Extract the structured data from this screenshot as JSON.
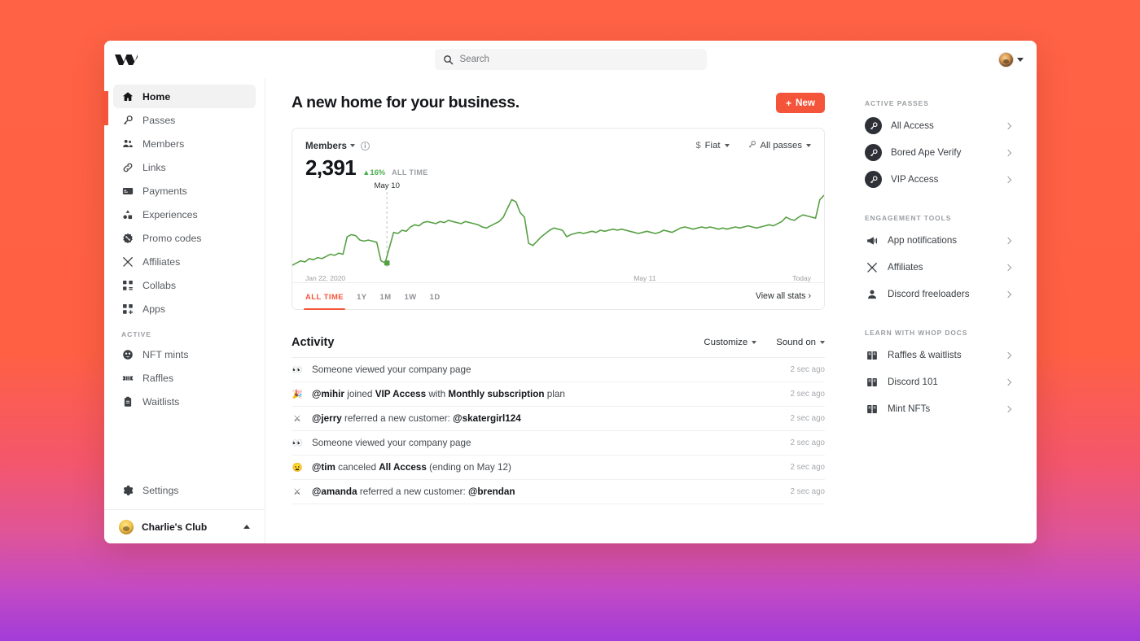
{
  "topbar": {
    "logo_name": "whop-logo",
    "search_placeholder": "Search",
    "search_value": ""
  },
  "sidebar": {
    "items": [
      {
        "label": "Home",
        "icon": "home-icon",
        "active": true
      },
      {
        "label": "Passes",
        "icon": "key-icon",
        "active": false
      },
      {
        "label": "Members",
        "icon": "people-icon",
        "active": false
      },
      {
        "label": "Links",
        "icon": "link-icon",
        "active": false
      },
      {
        "label": "Payments",
        "icon": "card-icon",
        "active": false
      },
      {
        "label": "Experiences",
        "icon": "experiences-icon",
        "active": false
      },
      {
        "label": "Promo codes",
        "icon": "promo-tag-icon",
        "active": false
      },
      {
        "label": "Affiliates",
        "icon": "crossed-swords-icon",
        "active": false
      },
      {
        "label": "Collabs",
        "icon": "collabs-icon",
        "active": false
      },
      {
        "label": "Apps",
        "icon": "apps-plus-icon",
        "active": false
      }
    ],
    "section_active_label": "ACTIVE",
    "active_items": [
      {
        "label": "NFT mints",
        "icon": "nft-mint-icon"
      },
      {
        "label": "Raffles",
        "icon": "ticket-icon"
      },
      {
        "label": "Waitlists",
        "icon": "clipboard-icon"
      }
    ],
    "settings_label": "Settings",
    "settings_icon": "gear-icon",
    "account_name": "Charlie's Club",
    "account_avatar": "charlie-avatar"
  },
  "main": {
    "page_title": "A new home for your business.",
    "new_button": "New",
    "new_button_icon": "plus-icon"
  },
  "stat_card": {
    "metric_label": "Members",
    "info_glyph": "i",
    "currency_filter": "Fiat",
    "currency_icon": "dollar-icon",
    "passes_filter": "All passes",
    "passes_icon": "key-icon",
    "value": "2,391",
    "delta": "▲16%",
    "delta_period": "ALL TIME",
    "marker_label": "May 10",
    "axis_start": "Jan 22, 2020",
    "axis_mid": "May 11",
    "axis_end": "Today",
    "ranges": [
      {
        "label": "ALL TIME",
        "active": true
      },
      {
        "label": "1Y",
        "active": false
      },
      {
        "label": "1M",
        "active": false
      },
      {
        "label": "1W",
        "active": false
      },
      {
        "label": "1D",
        "active": false
      }
    ],
    "view_all": "View all stats",
    "view_all_chevron": "›",
    "line_color": "#56a044",
    "accent_color": "#f4553a"
  },
  "chart_data": {
    "type": "line",
    "title": "Members",
    "ylabel": "Members",
    "xlabel": "",
    "series": [
      {
        "name": "Members",
        "values": [
          18,
          20,
          22,
          21,
          24,
          23,
          25,
          24,
          26,
          28,
          27,
          29,
          28,
          44,
          46,
          45,
          41,
          40,
          41,
          40,
          39,
          22,
          20,
          34,
          48,
          47,
          50,
          49,
          53,
          55,
          54,
          57,
          58,
          57,
          56,
          58,
          57,
          59,
          58,
          57,
          56,
          58,
          57,
          56,
          55,
          53,
          52,
          54,
          56,
          58,
          62,
          70,
          78,
          76,
          66,
          62,
          38,
          36,
          40,
          44,
          47,
          50,
          52,
          51,
          50,
          44,
          46,
          47,
          48,
          47,
          48,
          49,
          48,
          50,
          49,
          50,
          51,
          50,
          51,
          50,
          49,
          48,
          47,
          48,
          49,
          48,
          47,
          48,
          50,
          49,
          48,
          50,
          52,
          53,
          52,
          51,
          52,
          53,
          52,
          53,
          52,
          51,
          52,
          51,
          52,
          53,
          52,
          53,
          54,
          53,
          52,
          53,
          54,
          55,
          54,
          56,
          58,
          62,
          60,
          59,
          62,
          64,
          63,
          62,
          61,
          78,
          82
        ]
      }
    ],
    "x_ticks": [
      "Jan 22, 2020",
      "May 11",
      "Today"
    ],
    "annotation": {
      "label": "May 10",
      "x_fraction": 0.178,
      "value": 48
    },
    "grid": false,
    "legend": "none",
    "ylim": [
      0,
      100
    ],
    "stat_value": 2391,
    "stat_change_pct": 16,
    "stat_period": "ALL TIME"
  },
  "activity": {
    "title": "Activity",
    "customize_label": "Customize",
    "sound_label": "Sound on",
    "rows": [
      {
        "icon": "eyes-emoji",
        "glyph": "👀",
        "segments": [
          {
            "t": "Someone viewed your company page",
            "b": false
          }
        ],
        "time": "2 sec ago"
      },
      {
        "icon": "party-popper-emoji",
        "glyph": "🎉",
        "segments": [
          {
            "t": "@mihir",
            "b": true
          },
          {
            "t": " joined ",
            "b": false
          },
          {
            "t": "VIP Access",
            "b": true
          },
          {
            "t": " with ",
            "b": false
          },
          {
            "t": "Monthly subscription",
            "b": true
          },
          {
            "t": " plan",
            "b": false
          }
        ],
        "time": "2 sec ago"
      },
      {
        "icon": "crossed-swords-emoji",
        "glyph": "⚔",
        "segments": [
          {
            "t": "@jerry",
            "b": true
          },
          {
            "t": " referred a new customer: ",
            "b": false
          },
          {
            "t": "@skatergirl124",
            "b": true
          }
        ],
        "time": "2 sec ago"
      },
      {
        "icon": "eyes-emoji",
        "glyph": "👀",
        "segments": [
          {
            "t": "Someone viewed your company page",
            "b": false
          }
        ],
        "time": "2 sec ago"
      },
      {
        "icon": "frowning-face-emoji",
        "glyph": "😦",
        "segments": [
          {
            "t": "@tim",
            "b": true
          },
          {
            "t": " canceled ",
            "b": false
          },
          {
            "t": "All Access",
            "b": true
          },
          {
            "t": " (ending on May 12)",
            "b": false
          }
        ],
        "time": "2 sec ago"
      },
      {
        "icon": "crossed-swords-emoji",
        "glyph": "⚔",
        "segments": [
          {
            "t": "@amanda",
            "b": true
          },
          {
            "t": " referred a new customer: ",
            "b": false
          },
          {
            "t": "@brendan",
            "b": true
          }
        ],
        "time": "2 sec ago"
      }
    ]
  },
  "rail": {
    "sections": [
      {
        "label": "ACTIVE PASSES",
        "style": "pass",
        "items": [
          {
            "label": "All Access",
            "icon": "key-circle-icon"
          },
          {
            "label": "Bored Ape Verify",
            "icon": "key-circle-icon"
          },
          {
            "label": "VIP Access",
            "icon": "key-circle-icon"
          }
        ]
      },
      {
        "label": "ENGAGEMENT TOOLS",
        "style": "tool",
        "items": [
          {
            "label": "App notifications",
            "icon": "megaphone-icon"
          },
          {
            "label": "Affiliates",
            "icon": "crossed-swords-icon"
          },
          {
            "label": "Discord freeloaders",
            "icon": "person-icon"
          }
        ]
      },
      {
        "label": "LEARN WITH WHOP DOCS",
        "style": "tool",
        "items": [
          {
            "label": "Raffles & waitlists",
            "icon": "book-icon"
          },
          {
            "label": "Discord 101",
            "icon": "book-icon"
          },
          {
            "label": "Mint NFTs",
            "icon": "book-icon"
          }
        ]
      }
    ]
  },
  "theme": {
    "bg_top": "#ff6245",
    "bg_bottom": "#a23cd8",
    "accent": "#f4553a",
    "green": "#56a044"
  }
}
